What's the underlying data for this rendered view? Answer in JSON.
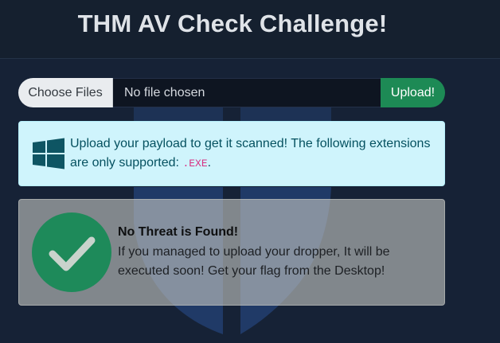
{
  "header": {
    "title": "THM AV Check Challenge!"
  },
  "upload": {
    "choose_label": "Choose Files",
    "file_status": "No file chosen",
    "upload_label": "Upload!"
  },
  "info": {
    "icon": "windows-logo-icon",
    "message": "Upload your payload to get it scanned! The following extensions are only supported:",
    "extension": ".EXE",
    "suffix": "."
  },
  "result": {
    "icon": "check-circle-icon",
    "title": "No Threat is Found!",
    "message": "If you managed to upload your dropper, It will be executed soon! Get your flag from the Desktop!"
  },
  "colors": {
    "page_bg": "#162236",
    "upload_button": "#1d8a55",
    "info_bg": "#cff4fc",
    "info_text": "#055160",
    "code_text": "#d63384",
    "check_green": "#1e8a5a"
  }
}
